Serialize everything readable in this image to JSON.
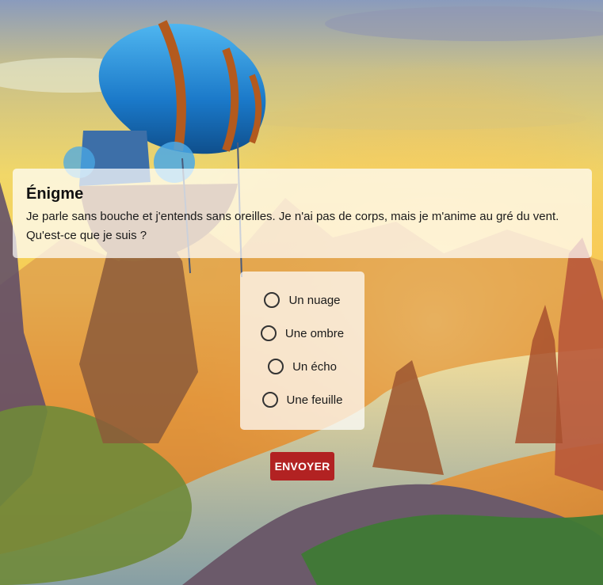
{
  "riddle": {
    "title": "Énigme",
    "text": "Je parle sans bouche et j'entends sans oreilles. Je n'ai pas de corps, mais je m'anime au gré du vent. Qu'est-ce que je suis ?"
  },
  "options": [
    {
      "label": "Un nuage",
      "selected": false
    },
    {
      "label": "Une ombre",
      "selected": false
    },
    {
      "label": "Un écho",
      "selected": false
    },
    {
      "label": "Une feuille",
      "selected": false
    }
  ],
  "submit": {
    "label": "ENVOYER"
  },
  "colors": {
    "submit_button": "#b22222",
    "sky_top": "#7f95b8",
    "sky_glow": "#f7d35a",
    "airship_blue": "#1e88d8"
  }
}
